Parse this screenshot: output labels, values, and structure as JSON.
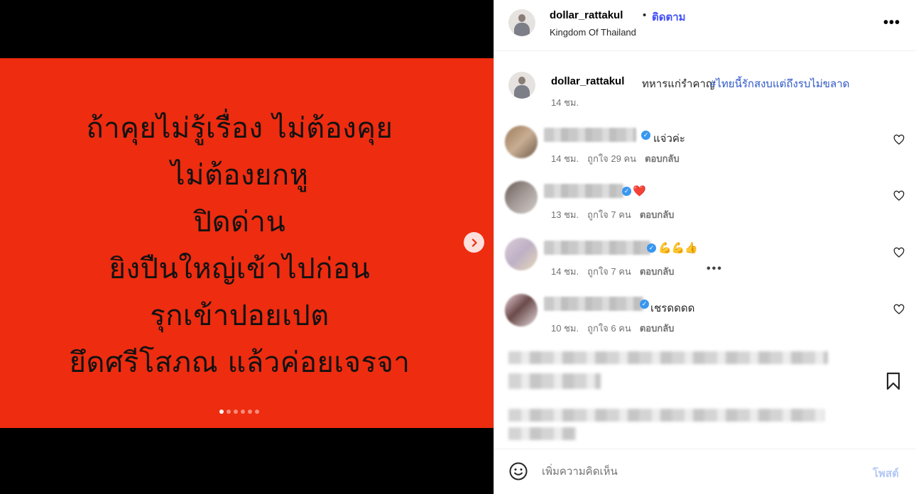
{
  "media": {
    "lines": [
      "ถ้าคุยไม่รู้เรื่อง ไม่ต้องคุย",
      "ไม่ต้องยกหู",
      "ปิดด่าน",
      "ยิงปืนใหญ่เข้าไปก่อน",
      "รุกเข้าปอยเปต",
      "ยึดศรีโสภณ แล้วค่อยเจรจา"
    ],
    "slide_count": 6,
    "active_slide": 1,
    "background_color": "#ee2c10",
    "next_icon": "chevron-right-icon"
  },
  "header": {
    "username": "dollar_rattakul",
    "separator": "•",
    "follow_label": "ติดตาม",
    "location": "Kingdom Of Thailand",
    "more_label": "•••"
  },
  "caption": {
    "username": "dollar_rattakul",
    "text": "ทหารแก่รำคาญ",
    "hashtag": "#ไทยนี้รักสงบแต่ถึงรบไม่ขลาด",
    "time": "14 ชม."
  },
  "comments": [
    {
      "text": "แจ่วค่ะ",
      "time": "14 ชม.",
      "likes": "ถูกใจ 29 คน",
      "reply": "ตอบกลับ",
      "verified": true
    },
    {
      "text": "❤️",
      "time": "13 ชม.",
      "likes": "ถูกใจ 7 คน",
      "reply": "ตอบกลับ",
      "verified": true
    },
    {
      "text": "💪💪👍",
      "time": "14 ชม.",
      "likes": "ถูกใจ 7 คน",
      "reply": "ตอบกลับ",
      "more": "•••",
      "verified": true
    },
    {
      "text": "เชรดดดด",
      "time": "10 ชม.",
      "likes": "ถูกใจ 6 คน",
      "reply": "ตอบกลับ",
      "verified": true
    }
  ],
  "footer": {
    "placeholder": "เพิ่มความคิดเห็น",
    "post_label": "โพสต์"
  },
  "colors": {
    "accent": "#4150f7",
    "hashtag": "#2f58c9",
    "verified": "#3897f0",
    "heart": "#e0172d",
    "post_disabled": "#b3c8f5"
  }
}
